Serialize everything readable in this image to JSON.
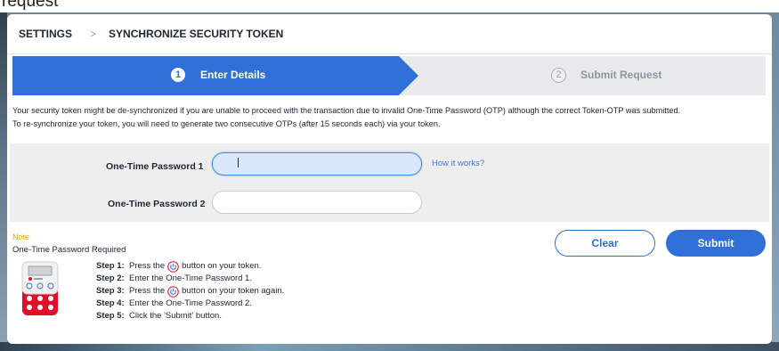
{
  "page_fragment": "request",
  "breadcrumb": {
    "root": "SETTINGS",
    "separator": ">",
    "current": "SYNCHRONIZE SECURITY TOKEN"
  },
  "stepper": {
    "steps": [
      {
        "number": "1",
        "label": "Enter Details",
        "state": "active"
      },
      {
        "number": "2",
        "label": "Submit Request",
        "state": "inactive"
      }
    ]
  },
  "intro": {
    "line1": "Your security token might be de-synchronized if you are unable to proceed with the transaction due to invalid One-Time Password (OTP) although the correct Token-OTP was submitted.",
    "line2": "To re-synchronize your token, you will need to generate two consecutive OTPs (after 15 seconds each) via your token."
  },
  "form": {
    "otp1_label": "One-Time Password 1",
    "otp1_value": "",
    "otp2_label": "One-Time Password 2",
    "otp2_value": "",
    "help_link": "How it works?"
  },
  "note": {
    "title": "Note",
    "subtitle": "One-Time Password Required",
    "steps": [
      {
        "key": "Step 1:",
        "before": "Press the",
        "after": "button on your token.",
        "icon": "power-icon"
      },
      {
        "key": "Step 2:",
        "text": "Enter the One-Time Password 1."
      },
      {
        "key": "Step 3:",
        "before": "Press the",
        "after": "button on your token again.",
        "icon": "power-icon"
      },
      {
        "key": "Step 4:",
        "text": "Enter the One-Time Password 2."
      },
      {
        "key": "Step 5:",
        "text": "Click the 'Submit' button."
      }
    ]
  },
  "actions": {
    "clear": "Clear",
    "submit": "Submit"
  },
  "colors": {
    "primary": "#2f6fd8",
    "note": "#f0a000",
    "token_red": "#e0102a"
  }
}
